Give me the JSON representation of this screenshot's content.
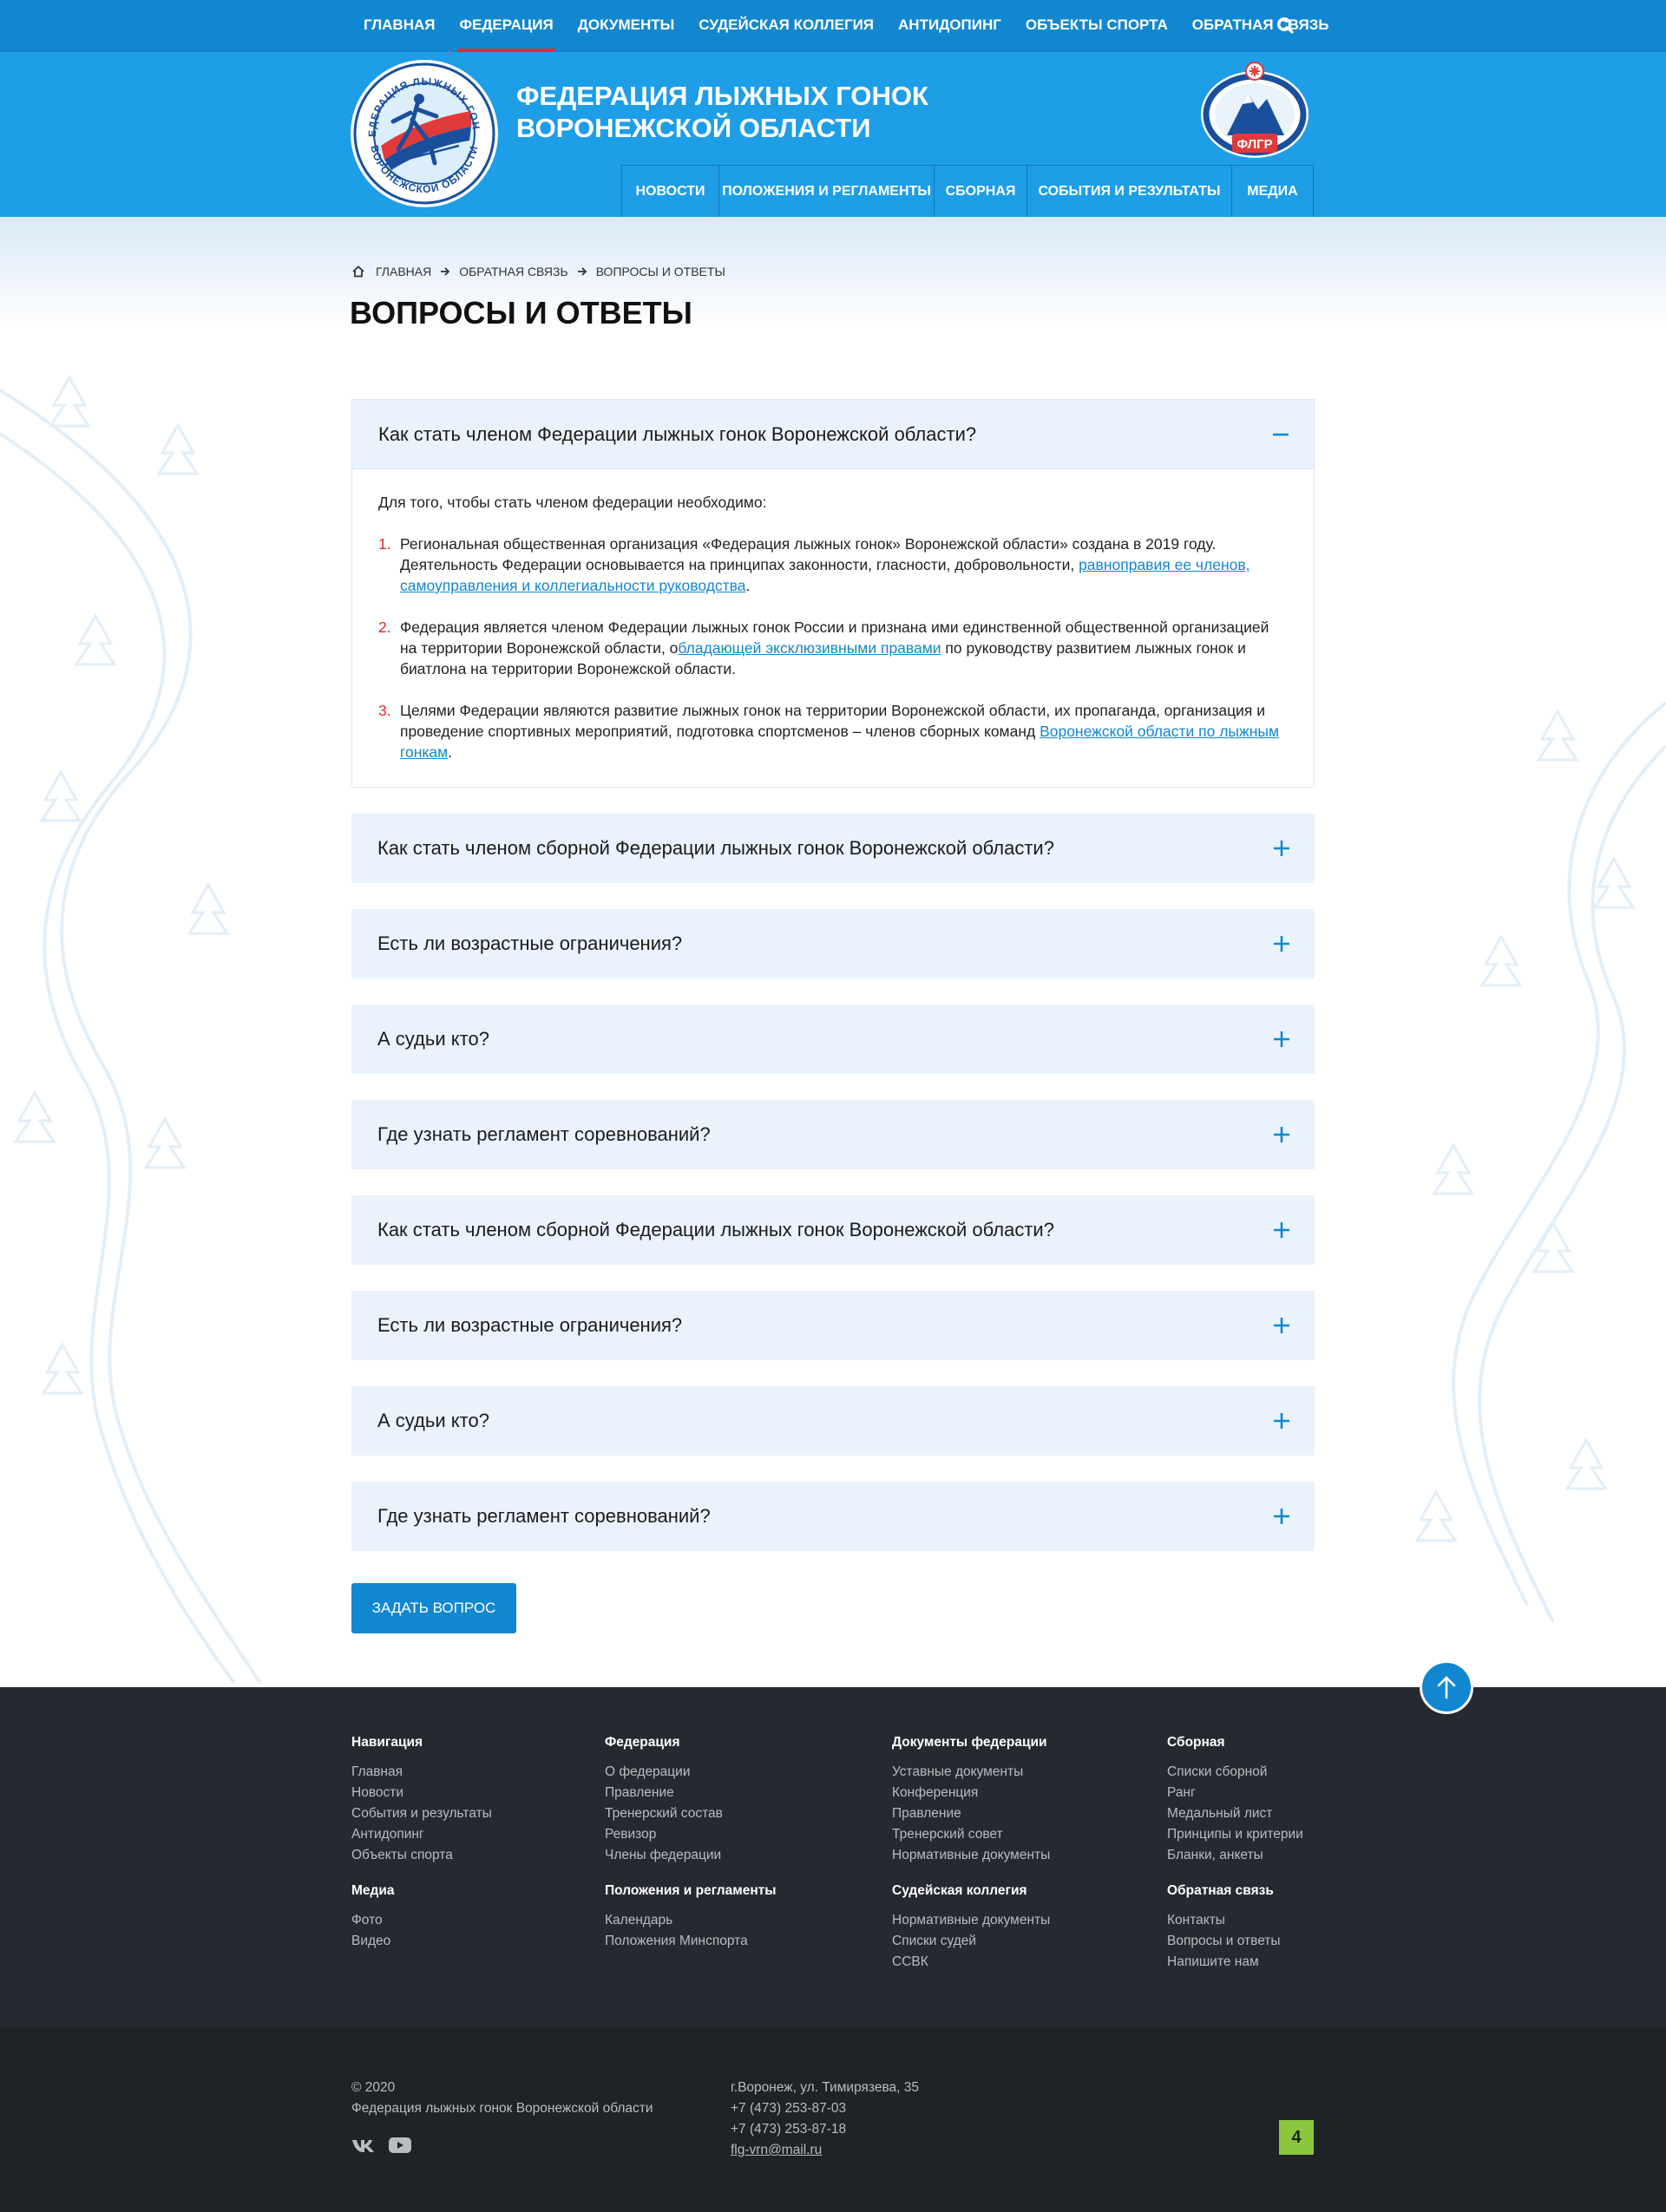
{
  "topnav": {
    "items": [
      "ГЛАВНАЯ",
      "ФЕДЕРАЦИЯ",
      "ДОКУМЕНТЫ",
      "СУДЕЙСКАЯ КОЛЛЕГИЯ",
      "АНТИДОПИНГ",
      "ОБЪЕКТЫ СПОРТА",
      "ОБРАТНАЯ СВЯЗЬ"
    ],
    "active_index": 1,
    "search_icon": "search-icon"
  },
  "header": {
    "title_line1": "ФЕДЕРАЦИЯ ЛЫЖНЫХ ГОНОК",
    "title_line2": "ВОРОНЕЖСКОЙ ОБЛАСТИ",
    "logo_ring_top": "ФЕДЕРАЦИЯ ЛЫЖНЫХ ГОНОК",
    "logo_ring_bottom": "ВОРОНЕЖСКОЙ ОБЛАСТИ",
    "fler_label": "ФЛГР"
  },
  "mainnav": {
    "items": [
      "НОВОСТИ",
      "ПОЛОЖЕНИЯ И РЕГЛАМЕНТЫ",
      "СБОРНАЯ",
      "СОБЫТИЯ И РЕЗУЛЬТАТЫ",
      "МЕДИА"
    ]
  },
  "breadcrumb": {
    "items": [
      "ГЛАВНАЯ",
      "ОБРАТНАЯ СВЯЗЬ",
      "ВОПРОСЫ И ОТВЕТЫ"
    ]
  },
  "page": {
    "title": "ВОПРОСЫ И ОТВЕТЫ"
  },
  "faq": {
    "open": {
      "question": "Как стать членом Федерации лыжных гонок Воронежской области?",
      "intro": "Для того, чтобы стать членом федерации необходимо:",
      "items": [
        {
          "num": "1.",
          "text": "Региональная общественная организация «Федерация лыжных гонок» Воронежской области» создана в 2019 году. Деятельность Федерации основывается на принципах законности, гласности, добровольности, ",
          "link": "равноправия ее членов, самоуправления и коллегиальности руководства",
          "after": "."
        },
        {
          "num": "2.",
          "text": "Федерация является членом Федерации лыжных гонок России и признана ими единственной общественной организацией на территории Воронежской области, о",
          "link": "бладающей эксклюзивными правами",
          "after": " по руководству развитием лыжных гонок и биатлона на территории Воронежской области."
        },
        {
          "num": "3.",
          "text": "Целями Федерации являются развитие лыжных гонок на территории Воронежской области, их пропаганда, организация и проведение спортивных мероприятий, подготовка спортсменов – членов сборных команд ",
          "link": "Воронежской области по лыжным гонкам",
          "after": "."
        }
      ]
    },
    "collapsed": [
      "Как стать членом сборной Федерации лыжных гонок Воронежской области?",
      "Есть ли возрастные ограничения?",
      "А судьи кто?",
      "Где узнать регламент соревнований?",
      "Как стать членом сборной Федерации лыжных гонок Воронежской области?",
      "Есть ли возрастные ограничения?",
      "А судьи кто?",
      "Где узнать регламент соревнований?"
    ]
  },
  "ask_button": "ЗАДАТЬ ВОПРОС",
  "footer": {
    "columns": [
      {
        "title": "Навигация",
        "links": [
          "Главная",
          "Новости",
          "События и результаты",
          "Антидопинг",
          "Объекты спорта"
        ]
      },
      {
        "title": "Федерация",
        "links": [
          "О федерации",
          "Правление",
          "Тренерский состав",
          "Ревизор",
          "Члены федерации"
        ]
      },
      {
        "title": "Документы федерации",
        "links": [
          "Уставные документы",
          "Конференция",
          "Правление",
          "Тренерский совет",
          "Нормативные документы"
        ]
      },
      {
        "title": "Сборная",
        "links": [
          "Списки сборной",
          "Ранг",
          "Медальный лист",
          "Принципы и критерии",
          "Бланки, анкеты"
        ]
      },
      {
        "title": "Медиа",
        "links": [
          "Фото",
          "Видео"
        ]
      },
      {
        "title": "Положения и регламенты",
        "links": [
          "Календарь",
          "Положения Минспорта"
        ]
      },
      {
        "title": "Судейская коллегия",
        "links": [
          "Нормативные документы",
          "Списки судей",
          "ССВК"
        ]
      },
      {
        "title": "Обратная связь",
        "links": [
          "Контакты",
          "Вопросы и ответы",
          "Напишите нам"
        ]
      }
    ],
    "copyright_year": "© 2020",
    "copyright_org": "Федерация лыжных гонок Воронежской области",
    "address": "г.Воронеж, ул. Тимирязева, 35",
    "phone1": "+7 (473) 253-87-03",
    "phone2": "+7 (473) 253-87-18",
    "email": "flg-vrn@mail.ru",
    "badge": "4"
  },
  "colors": {
    "topbar": "#1187d0",
    "header": "#1d9ee6",
    "accent_red": "#e52b2b",
    "faq_bg": "#eaf3fb",
    "footer": "#262a30",
    "footer_bottom": "#1f2227",
    "badge": "#8cc63f"
  }
}
